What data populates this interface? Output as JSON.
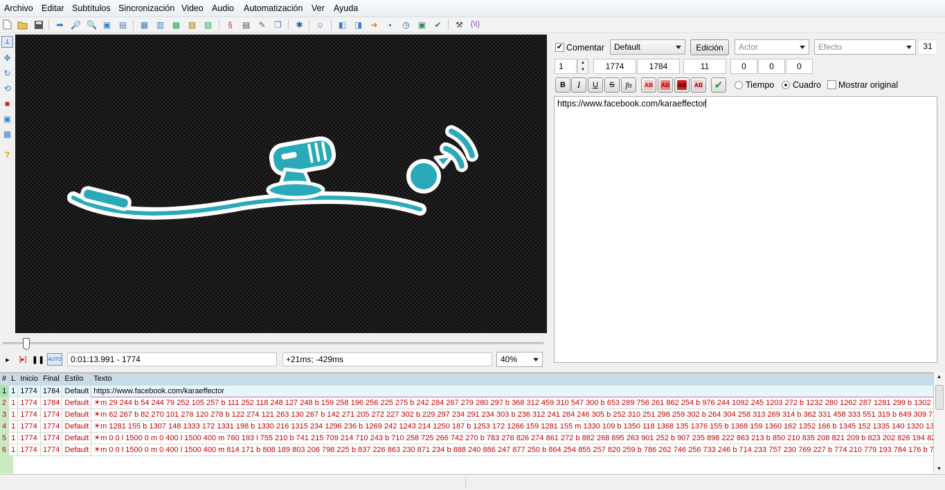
{
  "menu": [
    "Archivo",
    "Editar",
    "Subtítulos",
    "Sincronización",
    "Video",
    "Audio",
    "Automatización",
    "Ver",
    "Ayuda"
  ],
  "video": {
    "time_display": "0:01:13.991 - 1774",
    "offset_display": "+21ms; -429ms",
    "zoom": "40%",
    "auto_label": "AUTO"
  },
  "editor": {
    "comment_label": "Comentar",
    "comment_checked": true,
    "style": "Default",
    "edit_button": "Edición",
    "actor_placeholder": "Actor",
    "effect_placeholder": "Efecto",
    "char_count": "31",
    "layer": "1",
    "start_frame": "1774",
    "end_frame": "1784",
    "duration": "11",
    "margin_l": "0",
    "margin_r": "0",
    "margin_v": "0",
    "bold": "B",
    "italic": "I",
    "underline": "U",
    "strike": "S",
    "font": "fn",
    "color_label": "AB",
    "time_radio": "Tiempo",
    "frame_radio": "Cuadro",
    "show_original": "Mostrar original",
    "text": "https://www.facebook.com/karaeffector"
  },
  "grid": {
    "headers": [
      "#",
      "L",
      "Inicio",
      "Final",
      "Estilo",
      "Texto"
    ],
    "rows": [
      {
        "n": "1",
        "l": "1",
        "start": "1774",
        "end": "1784",
        "style": "Default",
        "text": "https://www.facebook.com/karaeffector"
      },
      {
        "n": "2",
        "l": "1",
        "start": "1774",
        "end": "1784",
        "style": "Default",
        "text": "☀m 29 244 b 54 244 79 252 105 257 b 111 252 118 248 127 248 b 159 258 196 256 225 275 b 242 284 267 279 280 297 b 368 312 459 310 547 300 b 653 289 756 261 862 254 b 976 244 1092 245 1203 272 b 1232 280 1262 287 1281 299 b 1302"
      },
      {
        "n": "3",
        "l": "1",
        "start": "1774",
        "end": "1774",
        "style": "Default",
        "text": "☀m 62 267 b 82 270 101 276 120 278 b 122 274 121 263 130 267 b 142 271 205 272 227 302 b 229 297 234 291 234 303 b 236 312 241 284 246 305 b 252 310 251 298 259 302 b 264 304 258 313 269 314 b 362 331 458 333 551 319 b 649 309 7"
      },
      {
        "n": "4",
        "l": "1",
        "start": "1774",
        "end": "1774",
        "style": "Default",
        "text": "☀m 1281 155 b 1307 148 1333 172 1331 198 b 1330 216 1315 234 1296 236 b 1269 242 1243 214 1250 187 b 1253 172 1266 159 1281 155 m 1330 109 b 1350 118 1368 135 1376 155 b 1368 159 1360 162 1352 166 b 1345 152 1335 140 1320 13"
      },
      {
        "n": "5",
        "l": "1",
        "start": "1774",
        "end": "1774",
        "style": "Default",
        "text": "☀m 0 0 l 1500 0 m 0 400 l 1500 400 m 760 193 l 755 210 b 741 215 709 214 710 243 b 710 258 725 266 742 270 b 783 276 826 274 861 272 b 882 268 895 263 901 252 b 907 235 898 222 863 213 b 850 210 835 208 821 209 b 823 202 826 194 82"
      },
      {
        "n": "6",
        "l": "1",
        "start": "1774",
        "end": "1774",
        "style": "Default",
        "text": "☀m 0 0 l 1500 0 m 0 400 l 1500 400 m 814 171 b 808 189 803 206 798 225 b 837 226 863 230 871 234 b 888 240 886 247 877 250 b 864 254 855 257 820 259 b 786 262 746 256 733 246 b 714 233 757 230 769 227 b 774 210 779 193 784 176 b 7"
      }
    ]
  },
  "colors": {
    "accent": "#2aaab9",
    "comment_text": "#c00000",
    "row_number_bg": "#c8ecc0",
    "header_bg": "#c9dbe6"
  }
}
